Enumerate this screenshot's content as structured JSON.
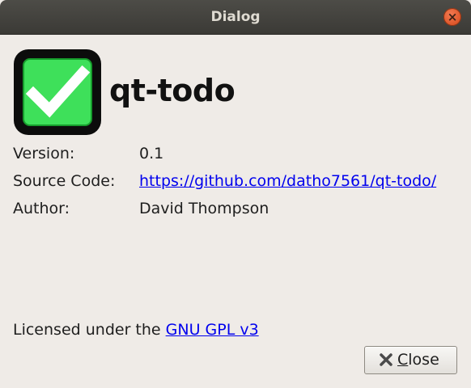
{
  "window": {
    "title": "Dialog",
    "close_glyph": "×"
  },
  "app": {
    "name": "qt-todo",
    "icon": "checkmark-icon",
    "icon_color": "#3ee05a"
  },
  "info": {
    "version_label": "Version:",
    "version_value": "0.1",
    "source_label": "Source Code:",
    "source_value": "https://github.com/datho7561/qt-todo/",
    "author_label": "Author:",
    "author_value": "David Thompson"
  },
  "license": {
    "prefix": "Licensed under the ",
    "link_text": "GNU GPL v3"
  },
  "buttons": {
    "close_mnemonic": "C",
    "close_rest": "lose",
    "close_icon": "x-icon"
  },
  "colors": {
    "link": "#0000ee",
    "titlebar": "#3f3e3a",
    "window_close": "#e35e2f",
    "background": "#efebe7"
  }
}
